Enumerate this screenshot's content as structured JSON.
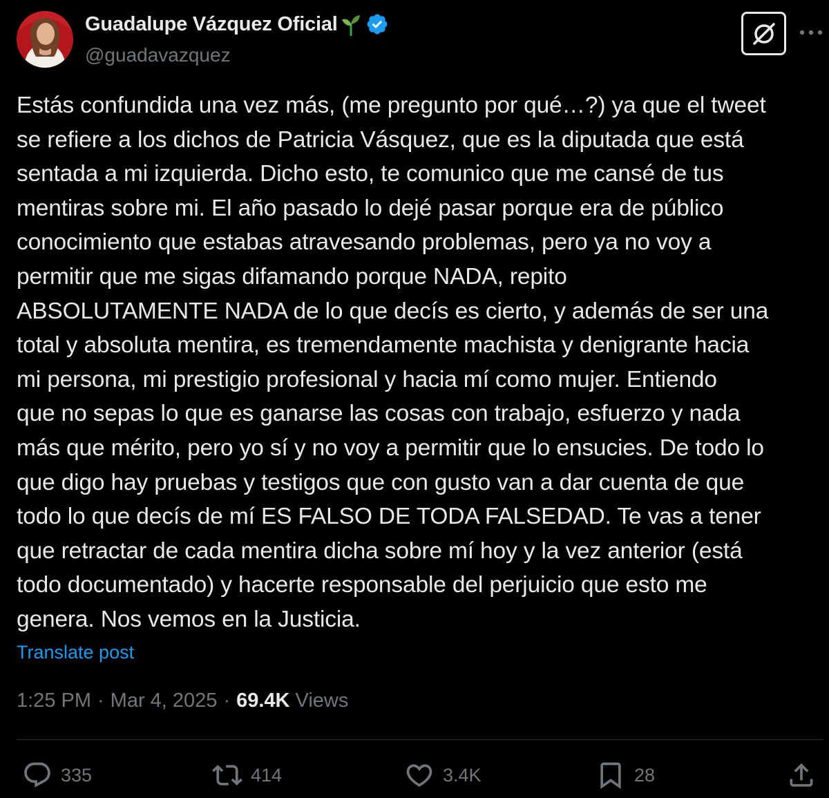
{
  "author": {
    "display_name": "Guadalupe Vázquez Oficial",
    "handle": "@guadavazquez",
    "name_emoji": "sprout-icon",
    "verified_badge": "verified-icon",
    "verified_color": "#1d9bf0"
  },
  "header_actions": {
    "grok_icon": "grok-icon",
    "more_icon": "more-horizontal-icon"
  },
  "post": {
    "lines": [
      "Estás confundida una vez más, (me pregunto por qué…?) ya que el tweet",
      "se refiere a los dichos de Patricia Vásquez, que es la diputada que está",
      "sentada a mi izquierda. Dicho esto, te comunico que me cansé de tus",
      "mentiras sobre mi. El año pasado lo dejé pasar porque era de público",
      "conocimiento que estabas atravesando problemas, pero ya no voy a",
      "permitir que me sigas difamando porque NADA, repito",
      "ABSOLUTAMENTE NADA de lo que decís es cierto, y además de ser una",
      "total y absoluta mentira, es tremendamente machista y denigrante hacia",
      "mi persona, mi prestigio profesional y hacia mí como mujer. Entiendo",
      "que no sepas lo que es ganarse las cosas con trabajo, esfuerzo y nada",
      "más que mérito, pero yo sí y no voy a permitir que lo ensucies. De todo lo",
      "que digo hay pruebas y testigos que con gusto van a dar cuenta de que",
      "todo lo que decís de mí ES FALSO DE TODA FALSEDAD. Te vas a tener",
      "que retractar de cada mentira dicha sobre mí hoy y la vez anterior (está",
      "todo documentado) y hacerte responsable del perjuicio que esto me",
      "genera. Nos vemos en la Justicia."
    ],
    "translate_label": "Translate post"
  },
  "meta": {
    "time": "1:25 PM",
    "separator": "·",
    "date": "Mar 4, 2025",
    "views_count": "69.4K",
    "views_label": "Views"
  },
  "actions": {
    "replies": "335",
    "reposts": "414",
    "likes": "3.4K",
    "bookmarks": "28"
  },
  "colors": {
    "background": "#000000",
    "text_primary": "#e7e9ea",
    "text_secondary": "#71767b",
    "link": "#1d9bf0",
    "divider": "#2f3336"
  }
}
